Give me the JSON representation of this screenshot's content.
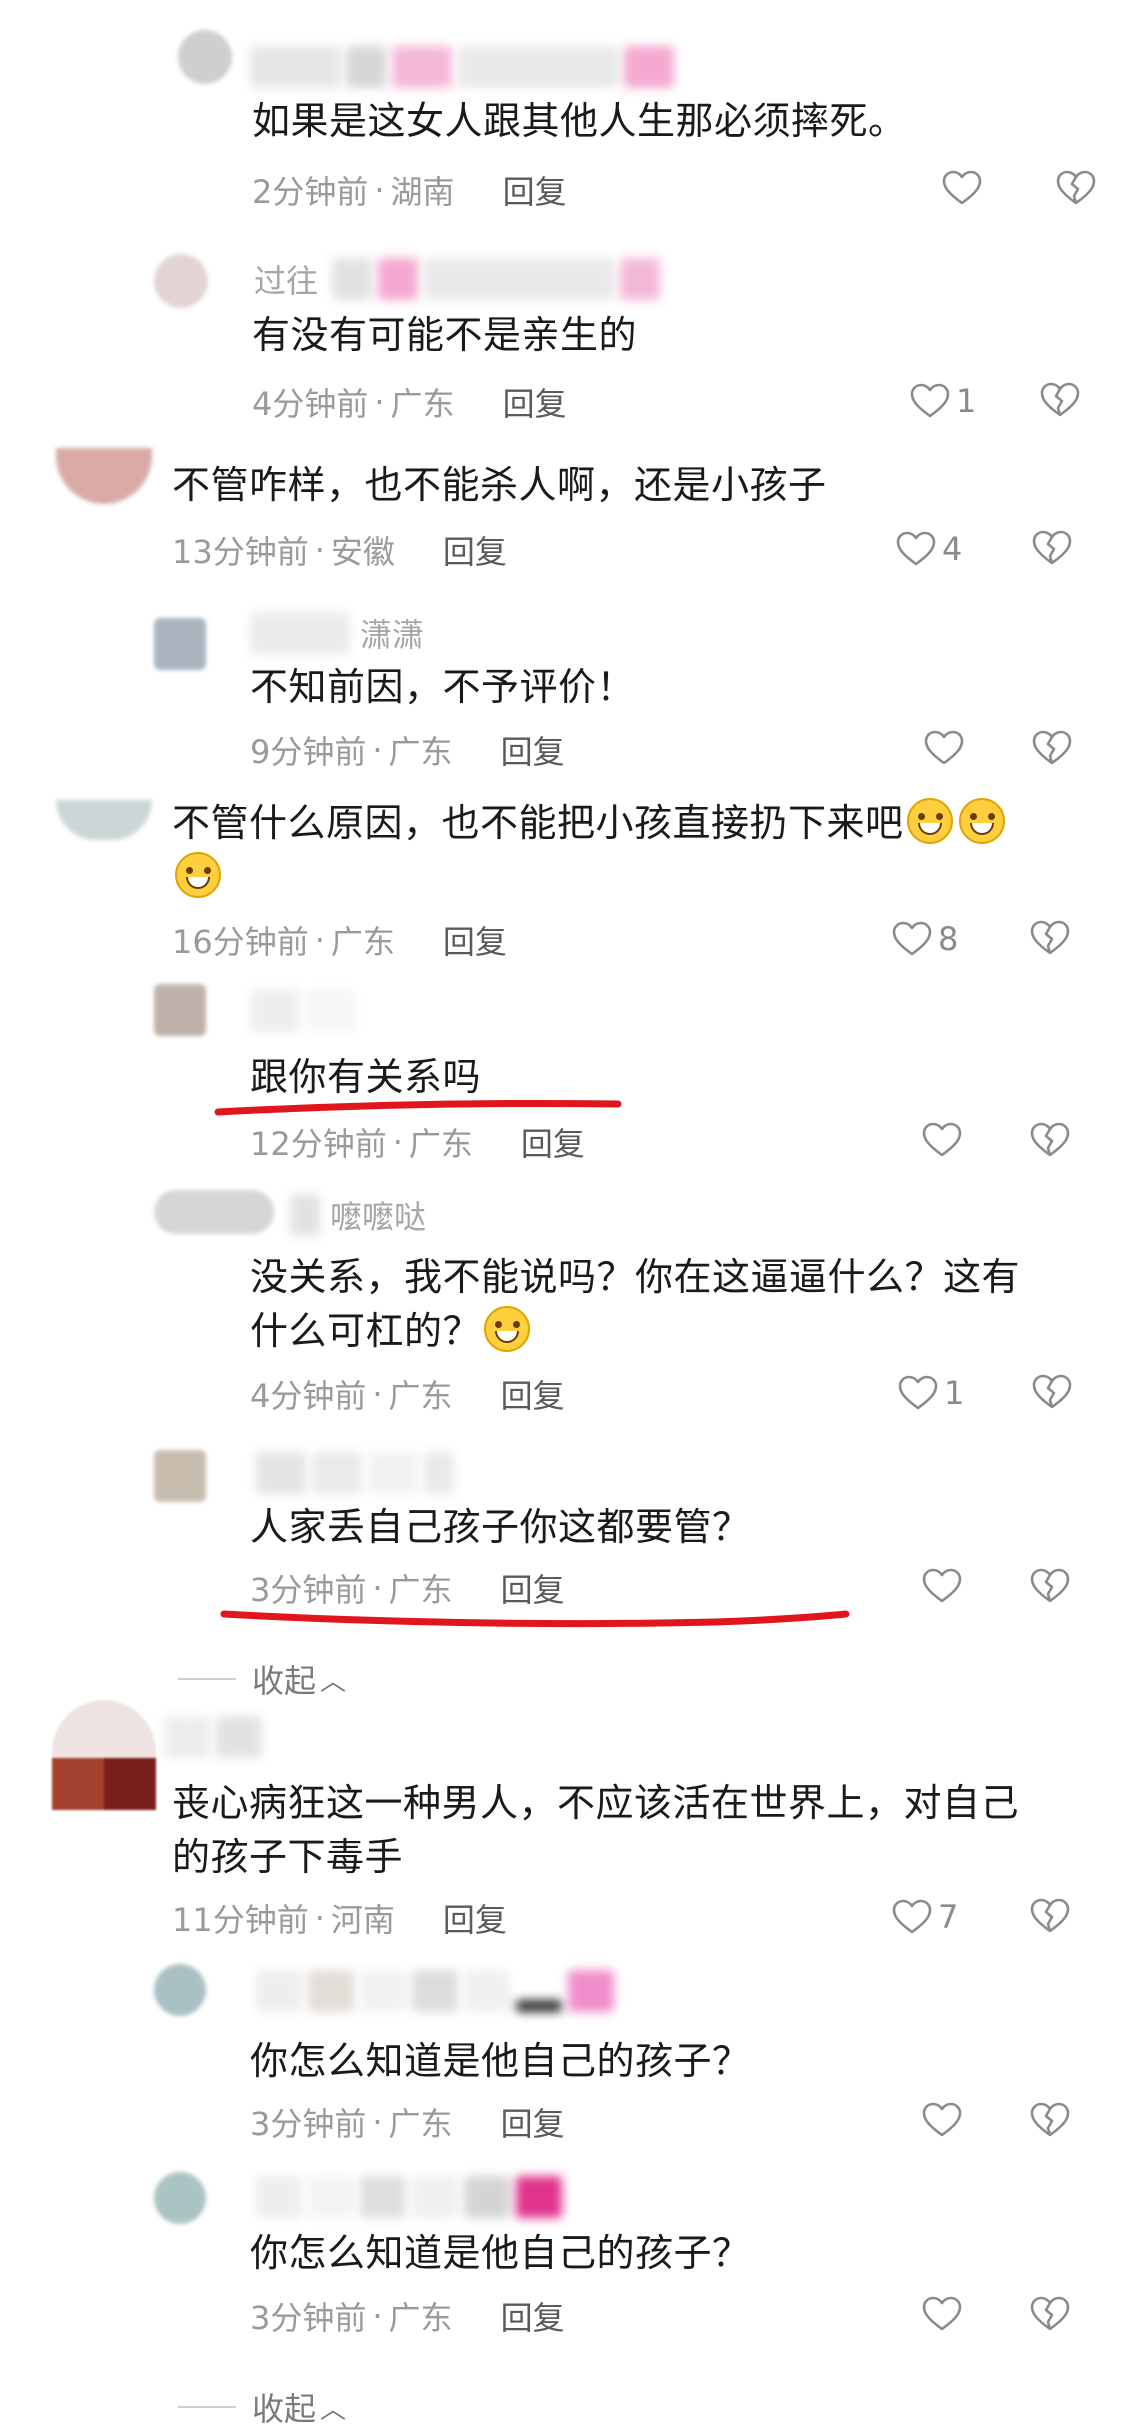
{
  "icons": {
    "like": "heart-outline-icon",
    "dislike": "broken-heart-icon",
    "emoji": "grinning-sweat-emoji",
    "collapse": "chevron-up-icon"
  },
  "colors": {
    "accent_underline": "#e0151e",
    "meta_gray": "#9a9a9a",
    "text": "#1a1a1a"
  },
  "comments": [
    {
      "text": "如果是这女人跟其他人生那必须摔死。",
      "time": "2分钟前",
      "location": "湖南",
      "reply": "回复",
      "likes": ""
    },
    {
      "username": "过往",
      "text": "有没有可能不是亲生的",
      "time": "4分钟前",
      "location": "广东",
      "reply": "回复",
      "likes": "1"
    },
    {
      "text": "不管咋样，也不能杀人啊，还是小孩子",
      "time": "13分钟前",
      "location": "安徽",
      "reply": "回复",
      "likes": "4"
    },
    {
      "username": "潇潇",
      "text": "不知前因，不予评价！",
      "time": "9分钟前",
      "location": "广东",
      "reply": "回复",
      "likes": ""
    },
    {
      "text_line1": "不管什么原因，也不能把小孩直接扔下来吧",
      "time": "16分钟前",
      "location": "广东",
      "reply": "回复",
      "likes": "8"
    },
    {
      "text": "跟你有关系吗",
      "time": "12分钟前",
      "location": "广东",
      "reply": "回复",
      "likes": ""
    },
    {
      "username": "嚒嚒哒",
      "text_line1": "没关系，我不能说吗？你在这逼逼什么？这有",
      "text_line2": "什么可杠的？",
      "time": "4分钟前",
      "location": "广东",
      "reply": "回复",
      "likes": "1"
    },
    {
      "text": "人家丢自己孩子你这都要管？",
      "time": "3分钟前",
      "location": "广东",
      "reply": "回复",
      "likes": ""
    },
    {
      "text_line1": "丧心病狂这一种男人，不应该活在世界上，对自己",
      "text_line2": "的孩子下毒手",
      "time": "11分钟前",
      "location": "河南",
      "reply": "回复",
      "likes": "7"
    },
    {
      "text": "你怎么知道是他自己的孩子？",
      "time": "3分钟前",
      "location": "广东",
      "reply": "回复",
      "likes": ""
    },
    {
      "text": "你怎么知道是他自己的孩子？",
      "time": "3分钟前",
      "location": "广东",
      "reply": "回复",
      "likes": ""
    }
  ],
  "collapse_label": "收起",
  "meta_separator": "·"
}
